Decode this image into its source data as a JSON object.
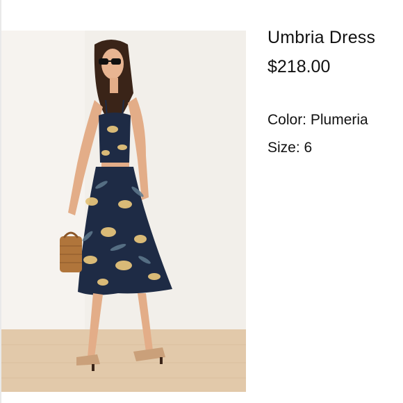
{
  "product": {
    "name": "Umbria Dress",
    "price": "$218.00",
    "color_text": "Color: Plumeria",
    "size_text": "Size: 6"
  },
  "photo": {
    "background_color": "#f2efea",
    "floor_color": "#e2c9aa",
    "dress_color": "#1e2b45",
    "print_color": "#e4c27a"
  }
}
